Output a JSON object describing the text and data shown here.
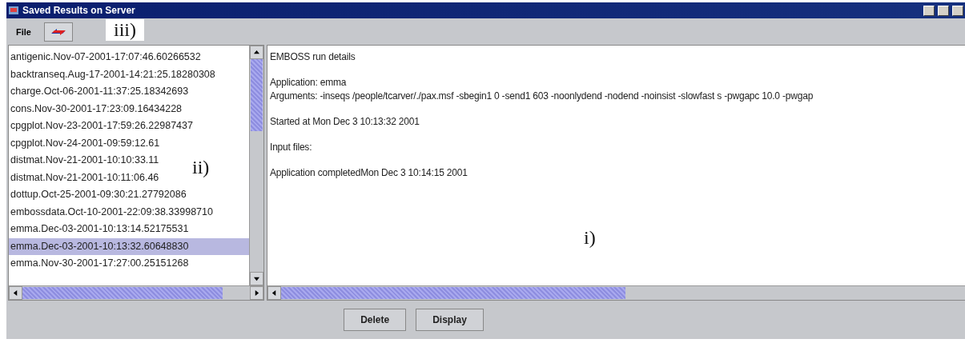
{
  "window": {
    "title": "Saved Results on Server"
  },
  "menu": {
    "items": [
      {
        "label": "File"
      }
    ]
  },
  "results": {
    "items": [
      {
        "label": "antigenic.Nov-07-2001-17:07:46.60266532",
        "selected": false
      },
      {
        "label": "backtranseq.Aug-17-2001-14:21:25.18280308",
        "selected": false
      },
      {
        "label": "charge.Oct-06-2001-11:37:25.18342693",
        "selected": false
      },
      {
        "label": "cons.Nov-30-2001-17:23:09.16434228",
        "selected": false
      },
      {
        "label": "cpgplot.Nov-23-2001-17:59:26.22987437",
        "selected": false
      },
      {
        "label": "cpgplot.Nov-24-2001-09:59:12.61",
        "selected": false
      },
      {
        "label": "distmat.Nov-21-2001-10:10:33.11",
        "selected": false
      },
      {
        "label": "distmat.Nov-21-2001-10:11:06.46",
        "selected": false
      },
      {
        "label": "dottup.Oct-25-2001-09:30:21.27792086",
        "selected": false
      },
      {
        "label": "embossdata.Oct-10-2001-22:09:38.33998710",
        "selected": false
      },
      {
        "label": "emma.Dec-03-2001-10:13:14.52175531",
        "selected": false
      },
      {
        "label": "emma.Dec-03-2001-10:13:32.60648830",
        "selected": true
      },
      {
        "label": "emma.Nov-30-2001-17:27:00.25151268",
        "selected": false
      }
    ]
  },
  "details": {
    "paragraphs": [
      [
        "EMBOSS run details"
      ],
      [
        "Application: emma",
        "Arguments: -inseqs /people/tcarver/./pax.msf  -sbegin1 0 -send1 603 -noonlydend  -nodend  -noinsist  -slowfast s -pwgapc 10.0 -pwgap"
      ],
      [
        "Started at Mon Dec  3 10:13:32 2001"
      ],
      [
        "Input files:"
      ],
      [
        "Application completedMon Dec  3 10:14:15 2001"
      ]
    ]
  },
  "buttons": [
    {
      "label": "Delete"
    },
    {
      "label": "Display"
    }
  ],
  "annotations": [
    {
      "label": "iii)"
    },
    {
      "label": "ii)"
    },
    {
      "label": "i)"
    }
  ]
}
